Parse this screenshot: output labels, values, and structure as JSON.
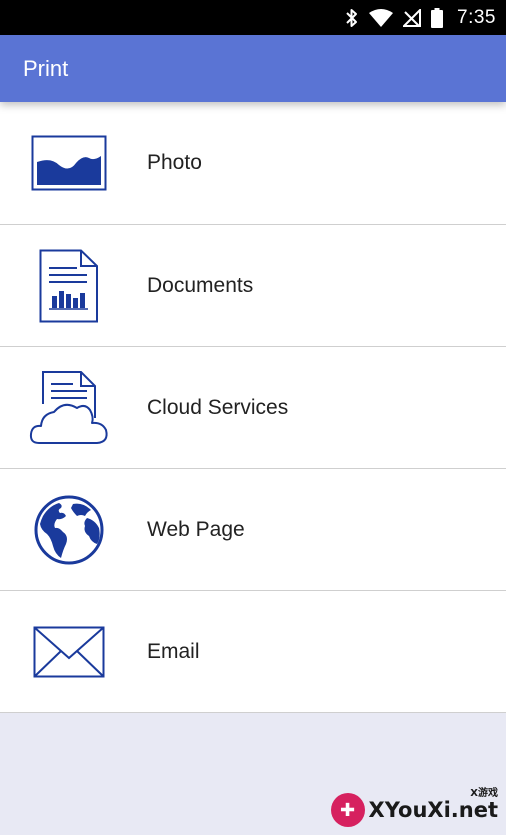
{
  "status_bar": {
    "time": "7:35",
    "icons": [
      "bluetooth-icon",
      "wifi-icon",
      "no-signal-icon",
      "battery-icon"
    ]
  },
  "app_bar": {
    "title": "Print"
  },
  "menu": {
    "items": [
      {
        "label": "Photo",
        "icon": "photo-icon"
      },
      {
        "label": "Documents",
        "icon": "document-icon"
      },
      {
        "label": "Cloud Services",
        "icon": "cloud-document-icon"
      },
      {
        "label": "Web Page",
        "icon": "globe-icon"
      },
      {
        "label": "Email",
        "icon": "envelope-icon"
      }
    ]
  },
  "watermark": {
    "text": "XYouXi.net",
    "sub": "X游戏"
  },
  "colors": {
    "app_bar": "#5a74d4",
    "icon": "#1a3a9c",
    "background": "#e8e9f4"
  }
}
